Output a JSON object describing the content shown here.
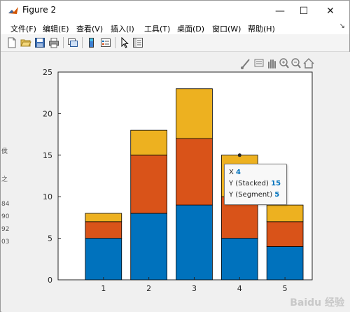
{
  "window": {
    "title": "Figure 2",
    "controls": {
      "minimize": "—",
      "maximize": "☐",
      "close": "✕"
    }
  },
  "menubar": {
    "items": [
      "文件(F)",
      "编辑(E)",
      "查看(V)",
      "插入(I)",
      "工具(T)",
      "桌面(D)",
      "窗口(W)",
      "帮助(H)"
    ],
    "overflow": "↘"
  },
  "toolbar": {
    "buttons": [
      "new-figure-icon",
      "open-file-icon",
      "save-icon",
      "print-icon",
      "link-plot-icon",
      "insert-colorbar-icon",
      "insert-legend-icon",
      "edit-plot-icon",
      "property-inspector-icon"
    ]
  },
  "axes_toolbar": {
    "buttons": [
      "brush-icon",
      "data-tips-icon",
      "pan-icon",
      "zoom-in-icon",
      "zoom-out-icon",
      "restore-view-icon"
    ]
  },
  "side_fragments": [
    "侯",
    "之",
    "84",
    "90",
    "92",
    "03"
  ],
  "colors": {
    "seg1": "#0072BD",
    "seg2": "#D95319",
    "seg3": "#EDB120"
  },
  "chart_data": {
    "type": "bar",
    "stacked": true,
    "categories": [
      "1",
      "2",
      "3",
      "4",
      "5"
    ],
    "series": [
      {
        "values": [
          5,
          8,
          9,
          5,
          4
        ]
      },
      {
        "values": [
          2,
          7,
          8,
          5,
          3
        ]
      },
      {
        "values": [
          1,
          3,
          6,
          5,
          2
        ]
      }
    ],
    "ylim": [
      0,
      25
    ],
    "xlim": [
      0,
      5.6
    ],
    "yticks": [
      0,
      5,
      10,
      15,
      20,
      25
    ],
    "title": "",
    "xlabel": "",
    "ylabel": "",
    "datatip": {
      "x_label": "X",
      "x_value": "4",
      "y1_label": "Y (Stacked)",
      "y1_value": "15",
      "y2_label": "Y (Segment)",
      "y2_value": "5",
      "point": [
        4,
        15
      ]
    }
  },
  "watermark": "Baidu 经验"
}
